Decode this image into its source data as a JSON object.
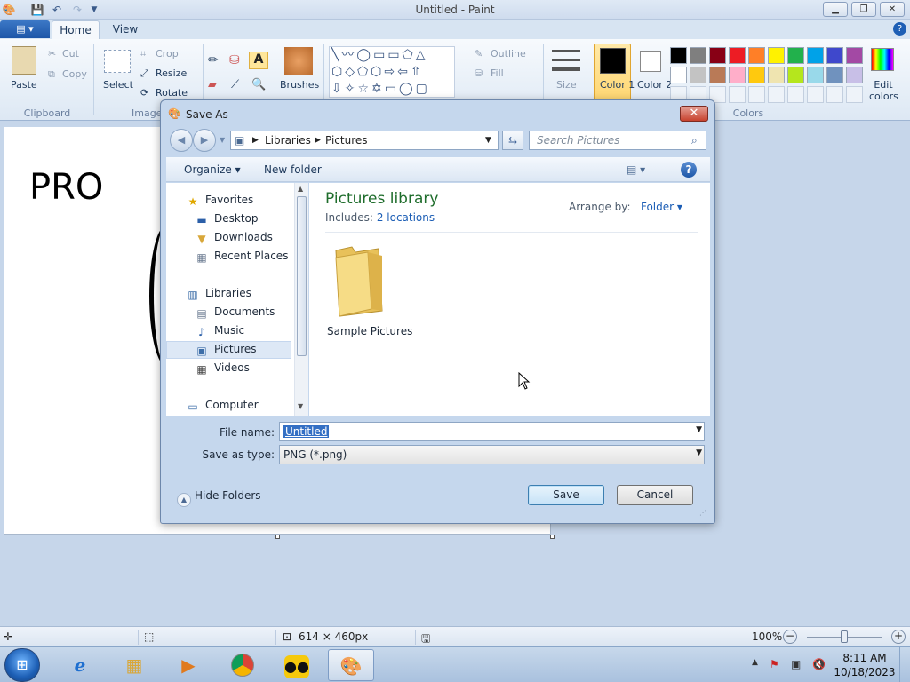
{
  "window": {
    "title": "Untitled - Paint",
    "minimize_icon": "minimize-icon",
    "maximize_icon": "restore-icon",
    "close_icon": "close-icon"
  },
  "quick_access": {
    "save_icon": "save-icon",
    "undo_icon": "undo-icon",
    "redo_icon": "redo-icon"
  },
  "tabs": [
    {
      "label": "Home",
      "active": true
    },
    {
      "label": "View",
      "active": false
    }
  ],
  "ribbon": {
    "clipboard": {
      "paste": "Paste",
      "cut": "Cut",
      "copy": "Copy",
      "group": "Clipboard"
    },
    "image": {
      "select": "Select",
      "crop": "Crop",
      "resize": "Resize",
      "rotate": "Rotate",
      "group": "Image"
    },
    "tools": {
      "brushes": "Brushes"
    },
    "shapes": {
      "outline": "Outline",
      "fill": "Fill"
    },
    "size": "Size",
    "color1": "Color 1",
    "color2": "Color 2",
    "colors_group": "Colors",
    "edit_colors": "Edit colors",
    "palette_row1": [
      "#000000",
      "#7f7f7f",
      "#880015",
      "#ed1c24",
      "#ff7f27",
      "#fff200",
      "#22b14c",
      "#00a2e8",
      "#3f48cc",
      "#a349a4"
    ],
    "palette_row2": [
      "#ffffff",
      "#c3c3c3",
      "#b97a57",
      "#ffaec9",
      "#ffc90e",
      "#efe4b0",
      "#b5e61d",
      "#99d9ea",
      "#7092be",
      "#c8bfe7"
    ]
  },
  "canvas": {
    "text": "PRO"
  },
  "status": {
    "dimensions": "614 × 460px",
    "zoom": "100%"
  },
  "dialog": {
    "title": "Save As",
    "close_icon": "close-icon",
    "breadcrumb": [
      "Libraries",
      "Pictures"
    ],
    "search_placeholder": "Search Pictures",
    "organize": "Organize",
    "new_folder": "New folder",
    "nav_items": [
      {
        "label": "Favorites",
        "icon": "star-icon"
      },
      {
        "label": "Desktop",
        "icon": "desktop-icon"
      },
      {
        "label": "Downloads",
        "icon": "downloads-icon"
      },
      {
        "label": "Recent Places",
        "icon": "recent-places-icon"
      },
      {
        "label": "Libraries",
        "icon": "libraries-icon"
      },
      {
        "label": "Documents",
        "icon": "documents-icon"
      },
      {
        "label": "Music",
        "icon": "music-icon"
      },
      {
        "label": "Pictures",
        "icon": "pictures-icon",
        "selected": true
      },
      {
        "label": "Videos",
        "icon": "videos-icon"
      },
      {
        "label": "Computer",
        "icon": "computer-icon"
      }
    ],
    "library_title": "Pictures library",
    "includes_label": "Includes:",
    "includes_link": "2 locations",
    "arrange_label": "Arrange by:",
    "arrange_value": "Folder",
    "folder_item": "Sample Pictures",
    "file_name_label": "File name:",
    "file_name_value": "Untitled",
    "save_type_label": "Save as type:",
    "save_type_value": "PNG (*.png)",
    "hide_folders": "Hide Folders",
    "save_button": "Save",
    "cancel_button": "Cancel"
  },
  "taskbar": {
    "time": "8:11 AM",
    "date": "10/18/2023",
    "apps": [
      "start-icon",
      "ie-icon",
      "explorer-icon",
      "media-player-icon",
      "chrome-icon",
      "panda-icon",
      "paint-icon"
    ]
  }
}
